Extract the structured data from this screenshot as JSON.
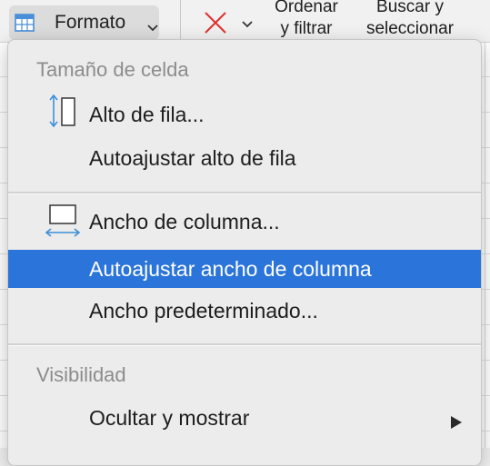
{
  "ribbon": {
    "format_label": "Formato",
    "sort_filter_line1": "Ordenar",
    "sort_filter_line2": "y filtrar",
    "find_select_line1": "Buscar y",
    "find_select_line2": "seleccionar",
    "icons": [
      "table-format-icon",
      "chevron-down-icon",
      "clear-icon",
      "chevron-down-icon"
    ]
  },
  "menu": {
    "sections": [
      {
        "header": "Tamaño de celda",
        "items": [
          {
            "label": "Alto de fila...",
            "icon": "row-height-icon"
          },
          {
            "label": "Autoajustar alto de fila"
          }
        ]
      },
      {
        "items": [
          {
            "label": "Ancho de columna...",
            "icon": "column-width-icon"
          },
          {
            "label": "Autoajustar ancho de columna",
            "selected": true
          },
          {
            "label": "Ancho predeterminado..."
          }
        ]
      },
      {
        "header": "Visibilidad",
        "items": [
          {
            "label": "Ocultar y mostrar",
            "submenu": true,
            "icon": "submenu-arrow-icon"
          }
        ]
      }
    ]
  },
  "colors": {
    "selection": "#2b74da",
    "icon_blue": "#3d8fd6",
    "clear_red": "#e0302f"
  }
}
